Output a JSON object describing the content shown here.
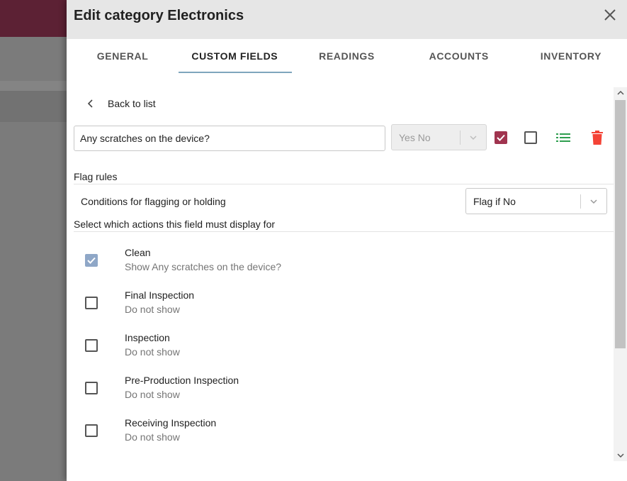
{
  "dialog": {
    "title": "Edit category Electronics",
    "close_icon": "close-icon"
  },
  "tabs": [
    {
      "label": "GENERAL",
      "active": false
    },
    {
      "label": "CUSTOM FIELDS",
      "active": true
    },
    {
      "label": "READINGS",
      "active": false
    },
    {
      "label": "ACCOUNTS",
      "active": false
    },
    {
      "label": "INVENTORY",
      "active": false
    }
  ],
  "back": {
    "label": "Back to list",
    "icon": "chevron-left-icon"
  },
  "field": {
    "question": "Any scratches on the device?",
    "type_value": "Yes No",
    "required_checked": true,
    "secondary_checked": false,
    "list_icon": "list-icon",
    "delete_icon": "trash-icon"
  },
  "flag_rules": {
    "heading": "Flag rules",
    "condition_label": "Conditions for flagging or holding",
    "condition_value": "Flag if No"
  },
  "actions_heading": "Select which actions this field must display for",
  "actions": [
    {
      "title": "Clean",
      "subtitle": "Show Any scratches on the device?",
      "checked": true
    },
    {
      "title": "Final Inspection",
      "subtitle": "Do not show",
      "checked": false
    },
    {
      "title": "Inspection",
      "subtitle": "Do not show",
      "checked": false
    },
    {
      "title": "Pre-Production Inspection",
      "subtitle": "Do not show",
      "checked": false
    },
    {
      "title": "Receiving Inspection",
      "subtitle": "Do not show",
      "checked": false
    }
  ],
  "colors": {
    "accent_maroon": "#a0344f",
    "tab_indicator": "#7fa6bd",
    "list_green": "#2e9e4f",
    "delete_red": "#f44336",
    "checked_blue": "#8fa7c7"
  }
}
